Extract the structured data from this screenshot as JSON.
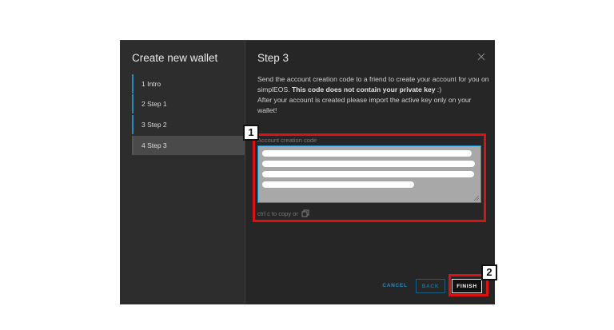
{
  "sidebar": {
    "title": "Create new wallet",
    "steps": [
      {
        "label": "1 Intro"
      },
      {
        "label": "2 Step 1"
      },
      {
        "label": "3 Step 2"
      },
      {
        "label": "4 Step 3"
      }
    ]
  },
  "main": {
    "title": "Step 3",
    "description_part1": "Send the account creation code to a friend to create your account for you on simplEOS. ",
    "description_bold": "This code does not contain your private key",
    "description_part2": " :)",
    "description_line2": "After your account is created please import the active key only on your wallet!",
    "field_label": "Account creation code",
    "copy_hint": "ctrl c to copy or"
  },
  "buttons": {
    "cancel": "CANCEL",
    "back": "BACK",
    "finish": "FINISH"
  },
  "annotations": {
    "badge1": "1",
    "badge2": "2",
    "highlight_color": "#e01010"
  },
  "icons": [
    "close-icon",
    "copy-icon",
    "resize-handle-icon"
  ]
}
